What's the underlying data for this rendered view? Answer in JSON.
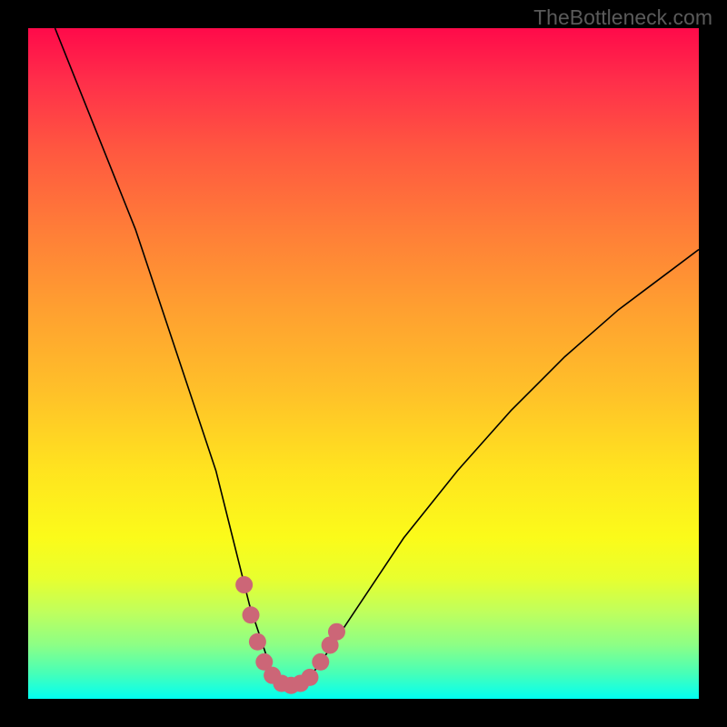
{
  "watermark": "TheBottleneck.com",
  "chart_data": {
    "type": "line",
    "title": "",
    "xlabel": "",
    "ylabel": "",
    "xlim": [
      0,
      100
    ],
    "ylim": [
      0,
      100
    ],
    "series": [
      {
        "name": "bottleneck-curve",
        "x": [
          4,
          6,
          8,
          10,
          12,
          14,
          16,
          18,
          20,
          22,
          24,
          26,
          28,
          30,
          32,
          33,
          34,
          35,
          36,
          37,
          38,
          39,
          40,
          41,
          42,
          44,
          48,
          52,
          56,
          60,
          64,
          68,
          72,
          76,
          80,
          84,
          88,
          92,
          96,
          100
        ],
        "values": [
          100,
          95,
          90,
          85,
          80,
          75,
          70,
          64,
          58,
          52,
          46,
          40,
          34,
          26,
          18,
          14,
          11,
          8,
          5,
          3,
          2.2,
          2,
          2,
          2.2,
          3.2,
          6,
          12,
          18,
          24,
          29,
          34,
          38.5,
          43,
          47,
          51,
          54.5,
          58,
          61,
          64,
          67
        ]
      }
    ],
    "markers": {
      "name": "optimal-zone",
      "color": "#cc6677",
      "points": [
        {
          "x": 32.2,
          "y": 17
        },
        {
          "x": 33.2,
          "y": 12.5
        },
        {
          "x": 34.2,
          "y": 8.5
        },
        {
          "x": 35.2,
          "y": 5.5
        },
        {
          "x": 36.4,
          "y": 3.5
        },
        {
          "x": 37.8,
          "y": 2.3
        },
        {
          "x": 39.2,
          "y": 2
        },
        {
          "x": 40.6,
          "y": 2.3
        },
        {
          "x": 42.0,
          "y": 3.2
        },
        {
          "x": 43.6,
          "y": 5.5
        },
        {
          "x": 45.0,
          "y": 8.0
        },
        {
          "x": 46.0,
          "y": 10.0
        }
      ]
    }
  }
}
